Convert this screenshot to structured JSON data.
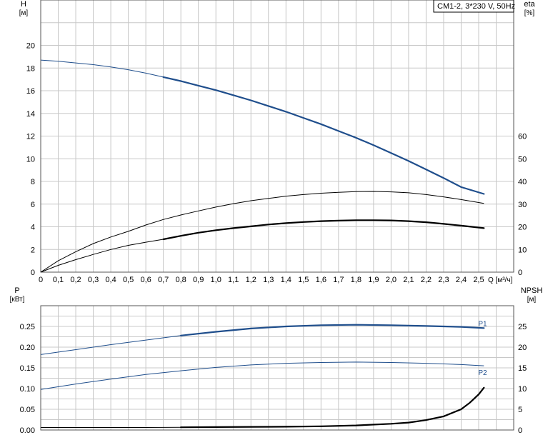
{
  "legend": "CM1-2, 3*230 V, 50Hz",
  "chart_data": [
    {
      "type": "line",
      "title": "",
      "x_axis": {
        "label": "Q",
        "unit": "[м³/ч]",
        "range": [
          0,
          2.7
        ],
        "ticks": [
          "0",
          "0,1",
          "0,2",
          "0,3",
          "0,4",
          "0,5",
          "0,6",
          "0,7",
          "0,8",
          "0,9",
          "1,0",
          "1,1",
          "1,2",
          "1,3",
          "1,4",
          "1,5",
          "1,6",
          "1,7",
          "1,8",
          "1,9",
          "2,0",
          "2,1",
          "2,2",
          "2,3",
          "2,4",
          "2,5"
        ]
      },
      "y_axis_left": {
        "label": "H",
        "unit": "[м]",
        "range": [
          0,
          24
        ],
        "ticks": [
          "0",
          "2",
          "4",
          "6",
          "8",
          "10",
          "12",
          "14",
          "16",
          "18",
          "20"
        ]
      },
      "y_axis_right": {
        "label": "eta",
        "unit": "[%]",
        "range": [
          0,
          120
        ],
        "ticks": [
          "0",
          "10",
          "20",
          "30",
          "40",
          "50",
          "60"
        ]
      },
      "grid": true,
      "series": [
        {
          "id": "head",
          "axis": "left",
          "color": "#1f4e8c",
          "x": [
            0,
            0.1,
            0.2,
            0.3,
            0.4,
            0.5,
            0.6,
            0.7,
            0.8,
            0.9,
            1.0,
            1.1,
            1.2,
            1.3,
            1.4,
            1.5,
            1.6,
            1.7,
            1.8,
            1.9,
            2.0,
            2.1,
            2.2,
            2.3,
            2.4,
            2.53
          ],
          "y": [
            18.7,
            18.6,
            18.45,
            18.3,
            18.1,
            17.85,
            17.55,
            17.2,
            16.85,
            16.45,
            16.05,
            15.6,
            15.15,
            14.65,
            14.15,
            13.6,
            13.05,
            12.45,
            11.85,
            11.2,
            10.5,
            9.8,
            9.05,
            8.3,
            7.5,
            6.9
          ],
          "emphasis_from": 0.7
        },
        {
          "id": "efficiency-thin",
          "axis": "right",
          "color": "#000000",
          "x": [
            0,
            0.1,
            0.2,
            0.3,
            0.4,
            0.5,
            0.6,
            0.7,
            0.8,
            0.9,
            1.0,
            1.1,
            1.2,
            1.3,
            1.4,
            1.5,
            1.6,
            1.7,
            1.8,
            1.9,
            2.0,
            2.1,
            2.2,
            2.3,
            2.4,
            2.53
          ],
          "y": [
            0,
            5.0,
            9.0,
            12.6,
            15.5,
            18.0,
            20.8,
            23.2,
            25.2,
            27.0,
            28.7,
            30.2,
            31.5,
            32.5,
            33.5,
            34.2,
            34.8,
            35.2,
            35.5,
            35.6,
            35.4,
            35.0,
            34.2,
            33.2,
            32.0,
            30.3
          ],
          "emphasis_from": null
        },
        {
          "id": "efficiency-thick",
          "axis": "right",
          "color": "#000000",
          "x": [
            0,
            0.1,
            0.2,
            0.3,
            0.4,
            0.5,
            0.6,
            0.7,
            0.8,
            0.9,
            1.0,
            1.1,
            1.2,
            1.3,
            1.4,
            1.5,
            1.6,
            1.7,
            1.8,
            1.9,
            2.0,
            2.1,
            2.2,
            2.3,
            2.4,
            2.53
          ],
          "y": [
            0,
            3.0,
            5.5,
            7.8,
            10.0,
            11.8,
            13.2,
            14.5,
            16.0,
            17.4,
            18.5,
            19.4,
            20.2,
            21.0,
            21.6,
            22.1,
            22.5,
            22.7,
            22.9,
            22.9,
            22.8,
            22.5,
            22.0,
            21.3,
            20.5,
            19.4
          ],
          "emphasis_from": 0.7
        }
      ]
    },
    {
      "type": "line",
      "title": "",
      "x_axis": {
        "range": [
          0,
          2.7
        ]
      },
      "y_axis_left": {
        "label": "P",
        "unit": "[кВт]",
        "range": [
          0,
          0.3
        ],
        "ticks": [
          "0.00",
          "0.05",
          "0.10",
          "0.15",
          "0.20",
          "0.25"
        ]
      },
      "y_axis_right": {
        "label": "NPSH",
        "unit": "[м]",
        "range": [
          0,
          30
        ],
        "ticks": [
          "0",
          "5",
          "10",
          "15",
          "20",
          "25"
        ]
      },
      "grid": true,
      "series": [
        {
          "id": "P1",
          "name": "P1",
          "axis": "left",
          "color": "#1f4e8c",
          "x": [
            0,
            0.2,
            0.4,
            0.6,
            0.8,
            1.0,
            1.2,
            1.4,
            1.6,
            1.8,
            2.0,
            2.2,
            2.4,
            2.53
          ],
          "y": [
            0.182,
            0.194,
            0.206,
            0.217,
            0.228,
            0.237,
            0.245,
            0.25,
            0.253,
            0.254,
            0.253,
            0.251,
            0.249,
            0.246
          ],
          "emphasis_from": 0.7
        },
        {
          "id": "P2",
          "name": "P2",
          "axis": "left",
          "color": "#1f4e8c",
          "x": [
            0,
            0.2,
            0.4,
            0.6,
            0.8,
            1.0,
            1.2,
            1.4,
            1.6,
            1.8,
            2.0,
            2.2,
            2.4,
            2.53
          ],
          "y": [
            0.098,
            0.111,
            0.123,
            0.134,
            0.143,
            0.151,
            0.157,
            0.161,
            0.163,
            0.164,
            0.163,
            0.161,
            0.158,
            0.155
          ],
          "emphasis_from": null
        },
        {
          "id": "NPSH",
          "axis": "right",
          "color": "#000000",
          "x": [
            0,
            0.2,
            0.4,
            0.6,
            0.8,
            1.0,
            1.2,
            1.4,
            1.6,
            1.8,
            2.0,
            2.1,
            2.2,
            2.3,
            2.4,
            2.45,
            2.5,
            2.53
          ],
          "y": [
            0.6,
            0.6,
            0.6,
            0.6,
            0.65,
            0.7,
            0.75,
            0.8,
            0.9,
            1.1,
            1.5,
            1.8,
            2.4,
            3.3,
            5.0,
            6.6,
            8.6,
            10.2
          ],
          "emphasis_from": 0.7
        }
      ]
    }
  ]
}
